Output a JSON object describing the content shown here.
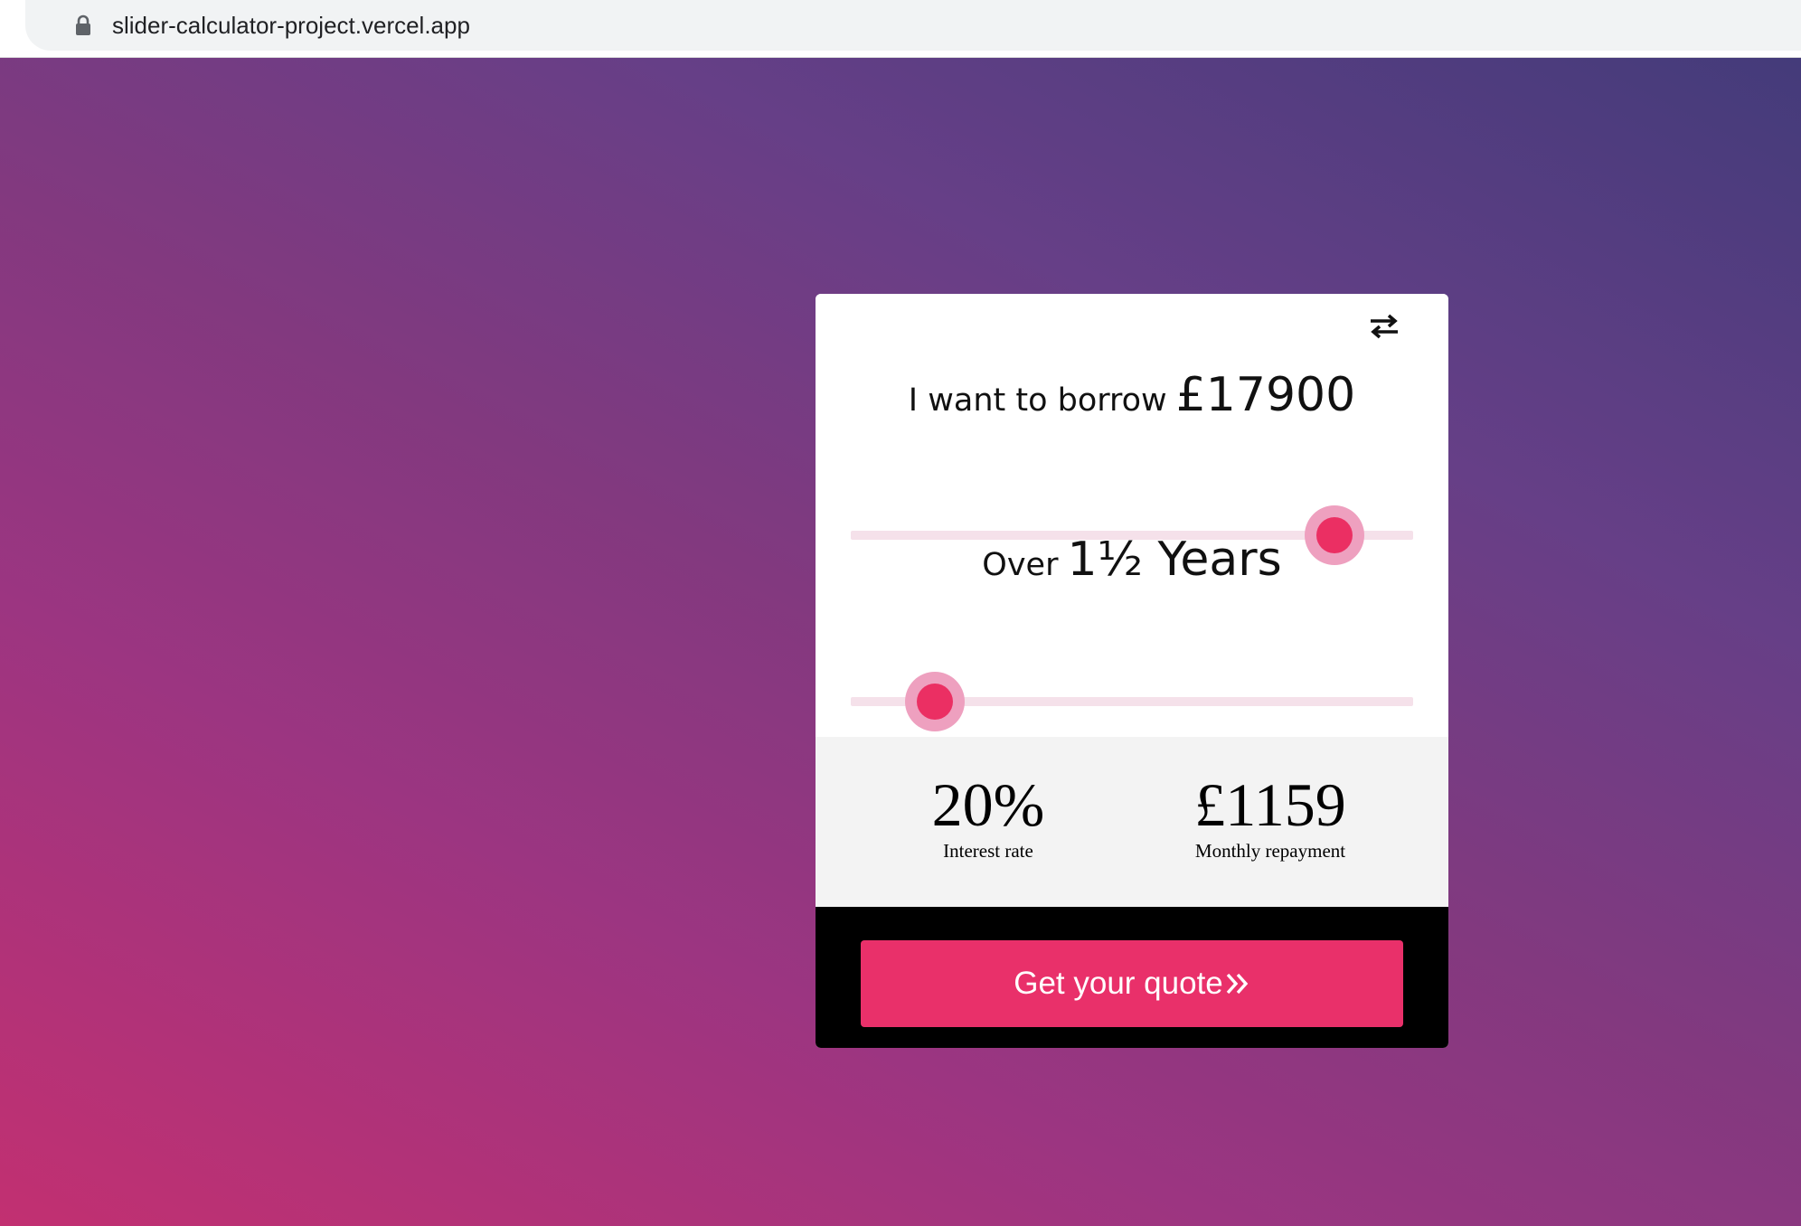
{
  "browser": {
    "url": "slider-calculator-project.vercel.app"
  },
  "calculator": {
    "borrow": {
      "label": "I want to borrow",
      "value": "£17900",
      "slider_fraction": 0.86
    },
    "term": {
      "label": "Over",
      "value": "1½ Years",
      "slider_fraction": 0.15
    },
    "interest": {
      "value": "20%",
      "caption": "Interest rate"
    },
    "repayment": {
      "value": "£1159",
      "caption": "Monthly repayment"
    },
    "cta_label": "Get your quote",
    "icons": {
      "swap": "swap-arrows-icon",
      "cta": "double-chevron-right-icon",
      "lock": "lock-icon"
    }
  },
  "colors": {
    "accent": "#e9306a",
    "thumb_halo": "#eea0bf",
    "track": "#f5e1ea",
    "footer": "#000000"
  }
}
